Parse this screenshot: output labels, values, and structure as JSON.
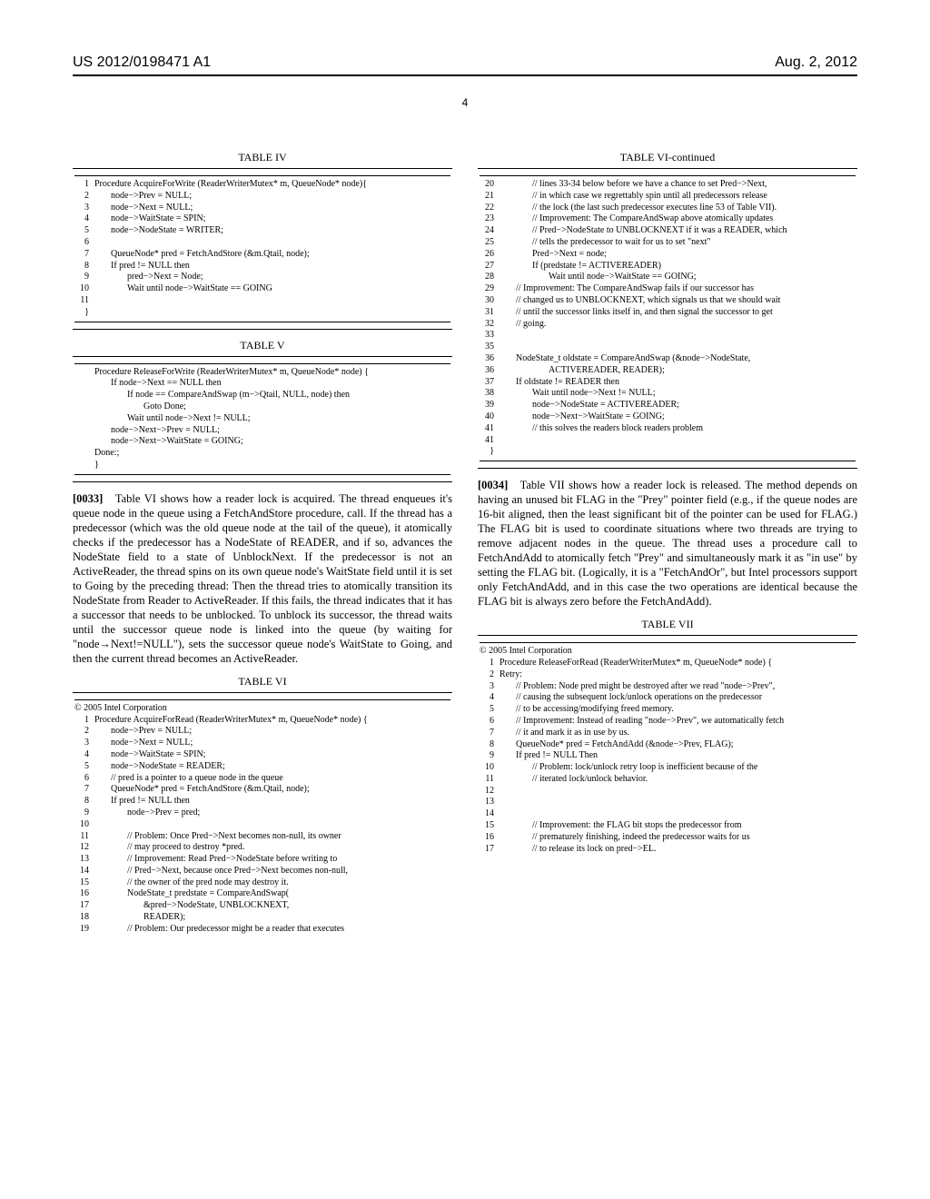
{
  "header": {
    "pub_number": "US 2012/0198471 A1",
    "date": "Aug. 2, 2012"
  },
  "page_number": "4",
  "left_col": {
    "table4": {
      "title": "TABLE IV",
      "rows": [
        {
          "ln": "1",
          "cls": "",
          "c": "Procedure AcquireForWrite (ReaderWriterMutex* m, QueueNode* node){"
        },
        {
          "ln": "2",
          "cls": "indent1",
          "c": "node−>Prev = NULL;"
        },
        {
          "ln": "3",
          "cls": "indent1",
          "c": "node−>Next = NULL;"
        },
        {
          "ln": "4",
          "cls": "indent1",
          "c": "node−>WaitState = SPIN;"
        },
        {
          "ln": "5",
          "cls": "indent1",
          "c": "node−>NodeState = WRITER;"
        },
        {
          "ln": "6",
          "cls": "",
          "c": ""
        },
        {
          "ln": "7",
          "cls": "indent1",
          "c": "QueueNode* pred = FetchAndStore (&m.Qtail, node);"
        },
        {
          "ln": "8",
          "cls": "indent1",
          "c": "If pred != NULL then"
        },
        {
          "ln": "9",
          "cls": "indent2",
          "c": "pred−>Next = Node;"
        },
        {
          "ln": "10",
          "cls": "indent2",
          "c": "Wait until node−>WaitState == GOING"
        },
        {
          "ln": "11 }",
          "cls": "",
          "c": ""
        }
      ]
    },
    "table5": {
      "title": "TABLE V",
      "rows": [
        {
          "ln": "",
          "cls": "",
          "c": "Procedure ReleaseForWrite (ReaderWriterMutex* m, QueueNode* node) {"
        },
        {
          "ln": "",
          "cls": "indent1",
          "c": "If node−>Next == NULL then"
        },
        {
          "ln": "",
          "cls": "indent2",
          "c": "If node == CompareAndSwap (m−>Qtail, NULL, node) then"
        },
        {
          "ln": "",
          "cls": "indent3",
          "c": "Goto Done;"
        },
        {
          "ln": "",
          "cls": "indent2",
          "c": "Wait until node−>Next != NULL;"
        },
        {
          "ln": "",
          "cls": "indent1",
          "c": "node−>Next−>Prev = NULL;"
        },
        {
          "ln": "",
          "cls": "indent1",
          "c": "node−>Next−>WaitState = GOING;"
        },
        {
          "ln": "",
          "cls": "",
          "c": "Done:;"
        },
        {
          "ln": "",
          "cls": "",
          "c": "}"
        }
      ]
    },
    "para33_num": "[0033]",
    "para33": "Table VI shows how a reader lock is acquired. The thread enqueues it's queue node in the queue using a FetchAndStore procedure, call. If the thread has a predecessor (which was the old queue node at the tail of the queue), it atomically checks if the predecessor has a NodeState of READER, and if so, advances the NodeState field to a state of UnblockNext. If the predecessor is not an ActiveReader, the thread spins on its own queue node's WaitState field until it is set to Going by the preceding thread: Then the thread tries to atomically transition its NodeState from Reader to ActiveReader. If this fails, the thread indicates that it has a successor that needs to be unblocked. To unblock its successor, the thread waits until the successor queue node is linked into the queue (by waiting for \"node→Next!=NULL\"), sets the successor queue node's WaitState to Going, and then the current thread becomes an ActiveReader.",
    "table6": {
      "title": "TABLE VI",
      "copyright": "© 2005 Intel Corporation",
      "rows": [
        {
          "ln": "1",
          "cls": "",
          "c": "Procedure AcquireForRead (ReaderWriterMutex* m, QueueNode* node) {"
        },
        {
          "ln": "2",
          "cls": "indent1",
          "c": "node−>Prev = NULL;"
        },
        {
          "ln": "3",
          "cls": "indent1",
          "c": "node−>Next = NULL;"
        },
        {
          "ln": "4",
          "cls": "indent1",
          "c": "node−>WaitState = SPIN;"
        },
        {
          "ln": "5",
          "cls": "indent1",
          "c": "node−>NodeState = READER;"
        },
        {
          "ln": "6",
          "cls": "indent1",
          "c": "// pred is a pointer to a queue node in the queue"
        },
        {
          "ln": "7",
          "cls": "indent1",
          "c": "QueueNode* pred = FetchAndStore (&m.Qtail, node);"
        },
        {
          "ln": "8",
          "cls": "indent1",
          "c": "If pred != NULL then"
        },
        {
          "ln": "9",
          "cls": "indent2",
          "c": "node−>Prev = pred;"
        },
        {
          "ln": "10",
          "cls": "",
          "c": ""
        },
        {
          "ln": "11",
          "cls": "indent2",
          "c": "// Problem: Once Pred−>Next becomes non-null, its owner"
        },
        {
          "ln": "12",
          "cls": "indent2",
          "c": "// may proceed to destroy *pred."
        },
        {
          "ln": "13",
          "cls": "indent2",
          "c": "// Improvement: Read Pred−>NodeState before writing to"
        },
        {
          "ln": "14",
          "cls": "indent2",
          "c": "// Pred−>Next, because once Pred−>Next becomes non-null,"
        },
        {
          "ln": "15",
          "cls": "indent2",
          "c": "// the owner of the pred node may destroy it."
        },
        {
          "ln": "16",
          "cls": "indent2",
          "c": "NodeState_t predstate = CompareAndSwap("
        },
        {
          "ln": "17",
          "cls": "indent3",
          "c": "&pred−>NodeState, UNBLOCKNEXT,"
        },
        {
          "ln": "18",
          "cls": "indent3",
          "c": "READER);"
        },
        {
          "ln": "19",
          "cls": "indent2",
          "c": "// Problem: Our predecessor might be a reader that executes"
        }
      ]
    }
  },
  "right_col": {
    "table6cont": {
      "title": "TABLE VI-continued",
      "rows": [
        {
          "ln": "20",
          "cls": "indent2",
          "c": "// lines 33-34 below before we have a chance to set Pred−>Next,"
        },
        {
          "ln": "21",
          "cls": "indent2",
          "c": "// in which case we regrettably spin until all predecessors release"
        },
        {
          "ln": "22",
          "cls": "indent2",
          "c": "// the lock (the last such predecessor executes line 53 of Table VII)."
        },
        {
          "ln": "23",
          "cls": "indent2",
          "c": "// Improvement: The CompareAndSwap above atomically updates"
        },
        {
          "ln": "24",
          "cls": "indent2",
          "c": "// Pred−>NodeState to UNBLOCKNEXT if it was a READER, which"
        },
        {
          "ln": "25",
          "cls": "indent2",
          "c": "// tells the predecessor to wait for us to set \"next\""
        },
        {
          "ln": "26",
          "cls": "indent2",
          "c": "Pred−>Next = node;"
        },
        {
          "ln": "27",
          "cls": "indent2",
          "c": "If (predstate != ACTIVEREADER)"
        },
        {
          "ln": "28",
          "cls": "indent3",
          "c": "Wait until node−>WaitState == GOING;"
        },
        {
          "ln": "29",
          "cls": "indent1",
          "c": "// Improvement: The CompareAndSwap fails if our successor has"
        },
        {
          "ln": "30",
          "cls": "indent1",
          "c": "// changed us to UNBLOCKNEXT, which signals us that we should wait"
        },
        {
          "ln": "31",
          "cls": "indent1",
          "c": "// until the successor links itself in, and then signal the successor to get"
        },
        {
          "ln": "32",
          "cls": "indent1",
          "c": "// going."
        },
        {
          "ln": "33",
          "cls": "",
          "c": ""
        },
        {
          "ln": "35",
          "cls": "",
          "c": ""
        },
        {
          "ln": "36",
          "cls": "indent1",
          "c": "NodeState_t oldstate = CompareAndSwap (&node−>NodeState,"
        },
        {
          "ln": "36",
          "cls": "indent3",
          "c": "ACTIVEREADER, READER);"
        },
        {
          "ln": "37",
          "cls": "indent1",
          "c": "If oldstate != READER then"
        },
        {
          "ln": "38",
          "cls": "indent2",
          "c": "Wait until node−>Next != NULL;"
        },
        {
          "ln": "39",
          "cls": "indent2",
          "c": "node−>NodeState = ACTIVEREADER;"
        },
        {
          "ln": "40",
          "cls": "indent2",
          "c": "node−>Next−>WaitState = GOING;"
        },
        {
          "ln": "41",
          "cls": "indent2",
          "c": "// this solves the readers block readers problem"
        },
        {
          "ln": "41 }",
          "cls": "",
          "c": ""
        }
      ]
    },
    "para34_num": "[0034]",
    "para34": "Table VII shows how a reader lock is released. The method depends on having an unused bit FLAG in the \"Prey\" pointer field (e.g., if the queue nodes are 16-bit aligned, then the least significant bit of the pointer can be used for FLAG.) The FLAG bit is used to coordinate situations where two threads are trying to remove adjacent nodes in the queue. The thread uses a procedure call to FetchAndAdd to atomically fetch \"Prey\" and simultaneously mark it as \"in use\" by setting the FLAG bit. (Logically, it is a \"FetchAndOr\", but Intel processors support only FetchAndAdd, and in this case the two operations are identical because the FLAG bit is always zero before the FetchAndAdd).",
    "table7": {
      "title": "TABLE VII",
      "copyright": "© 2005 Intel Corporation",
      "rows": [
        {
          "ln": "1",
          "cls": "",
          "c": "Procedure ReleaseForRead (ReaderWriterMutex* m, QueueNode* node) {"
        },
        {
          "ln": "2",
          "cls": "",
          "c": "Retry:"
        },
        {
          "ln": "3",
          "cls": "indent1",
          "c": "// Problem: Node pred might be destroyed after we read \"node−>Prev\","
        },
        {
          "ln": "4",
          "cls": "indent1",
          "c": "// causing the subsequent lock/unlock operations on the predecessor"
        },
        {
          "ln": "5",
          "cls": "indent1",
          "c": "// to be accessing/modifying freed memory."
        },
        {
          "ln": "6",
          "cls": "indent1",
          "c": "// Improvement: Instead of reading \"node−>Prev\", we automatically fetch"
        },
        {
          "ln": "7",
          "cls": "indent1",
          "c": "// it and mark it as in use by us."
        },
        {
          "ln": "8",
          "cls": "indent1",
          "c": "QueueNode* pred = FetchAndAdd (&node−>Prev, FLAG);"
        },
        {
          "ln": "9",
          "cls": "indent1",
          "c": "If pred != NULL Then"
        },
        {
          "ln": "10",
          "cls": "indent2",
          "c": "// Problem: lock/unlock retry loop is inefficient because of the"
        },
        {
          "ln": "11",
          "cls": "indent2",
          "c": "// iterated lock/unlock behavior."
        },
        {
          "ln": "12",
          "cls": "",
          "c": ""
        },
        {
          "ln": "13",
          "cls": "",
          "c": ""
        },
        {
          "ln": "14",
          "cls": "",
          "c": ""
        },
        {
          "ln": "15",
          "cls": "indent2",
          "c": "// Improvement: the FLAG bit stops the predecessor from"
        },
        {
          "ln": "16",
          "cls": "indent2",
          "c": "// prematurely finishing, indeed the predecessor waits for us"
        },
        {
          "ln": "17",
          "cls": "indent2",
          "c": "// to release its lock on pred−>EL."
        }
      ]
    }
  }
}
